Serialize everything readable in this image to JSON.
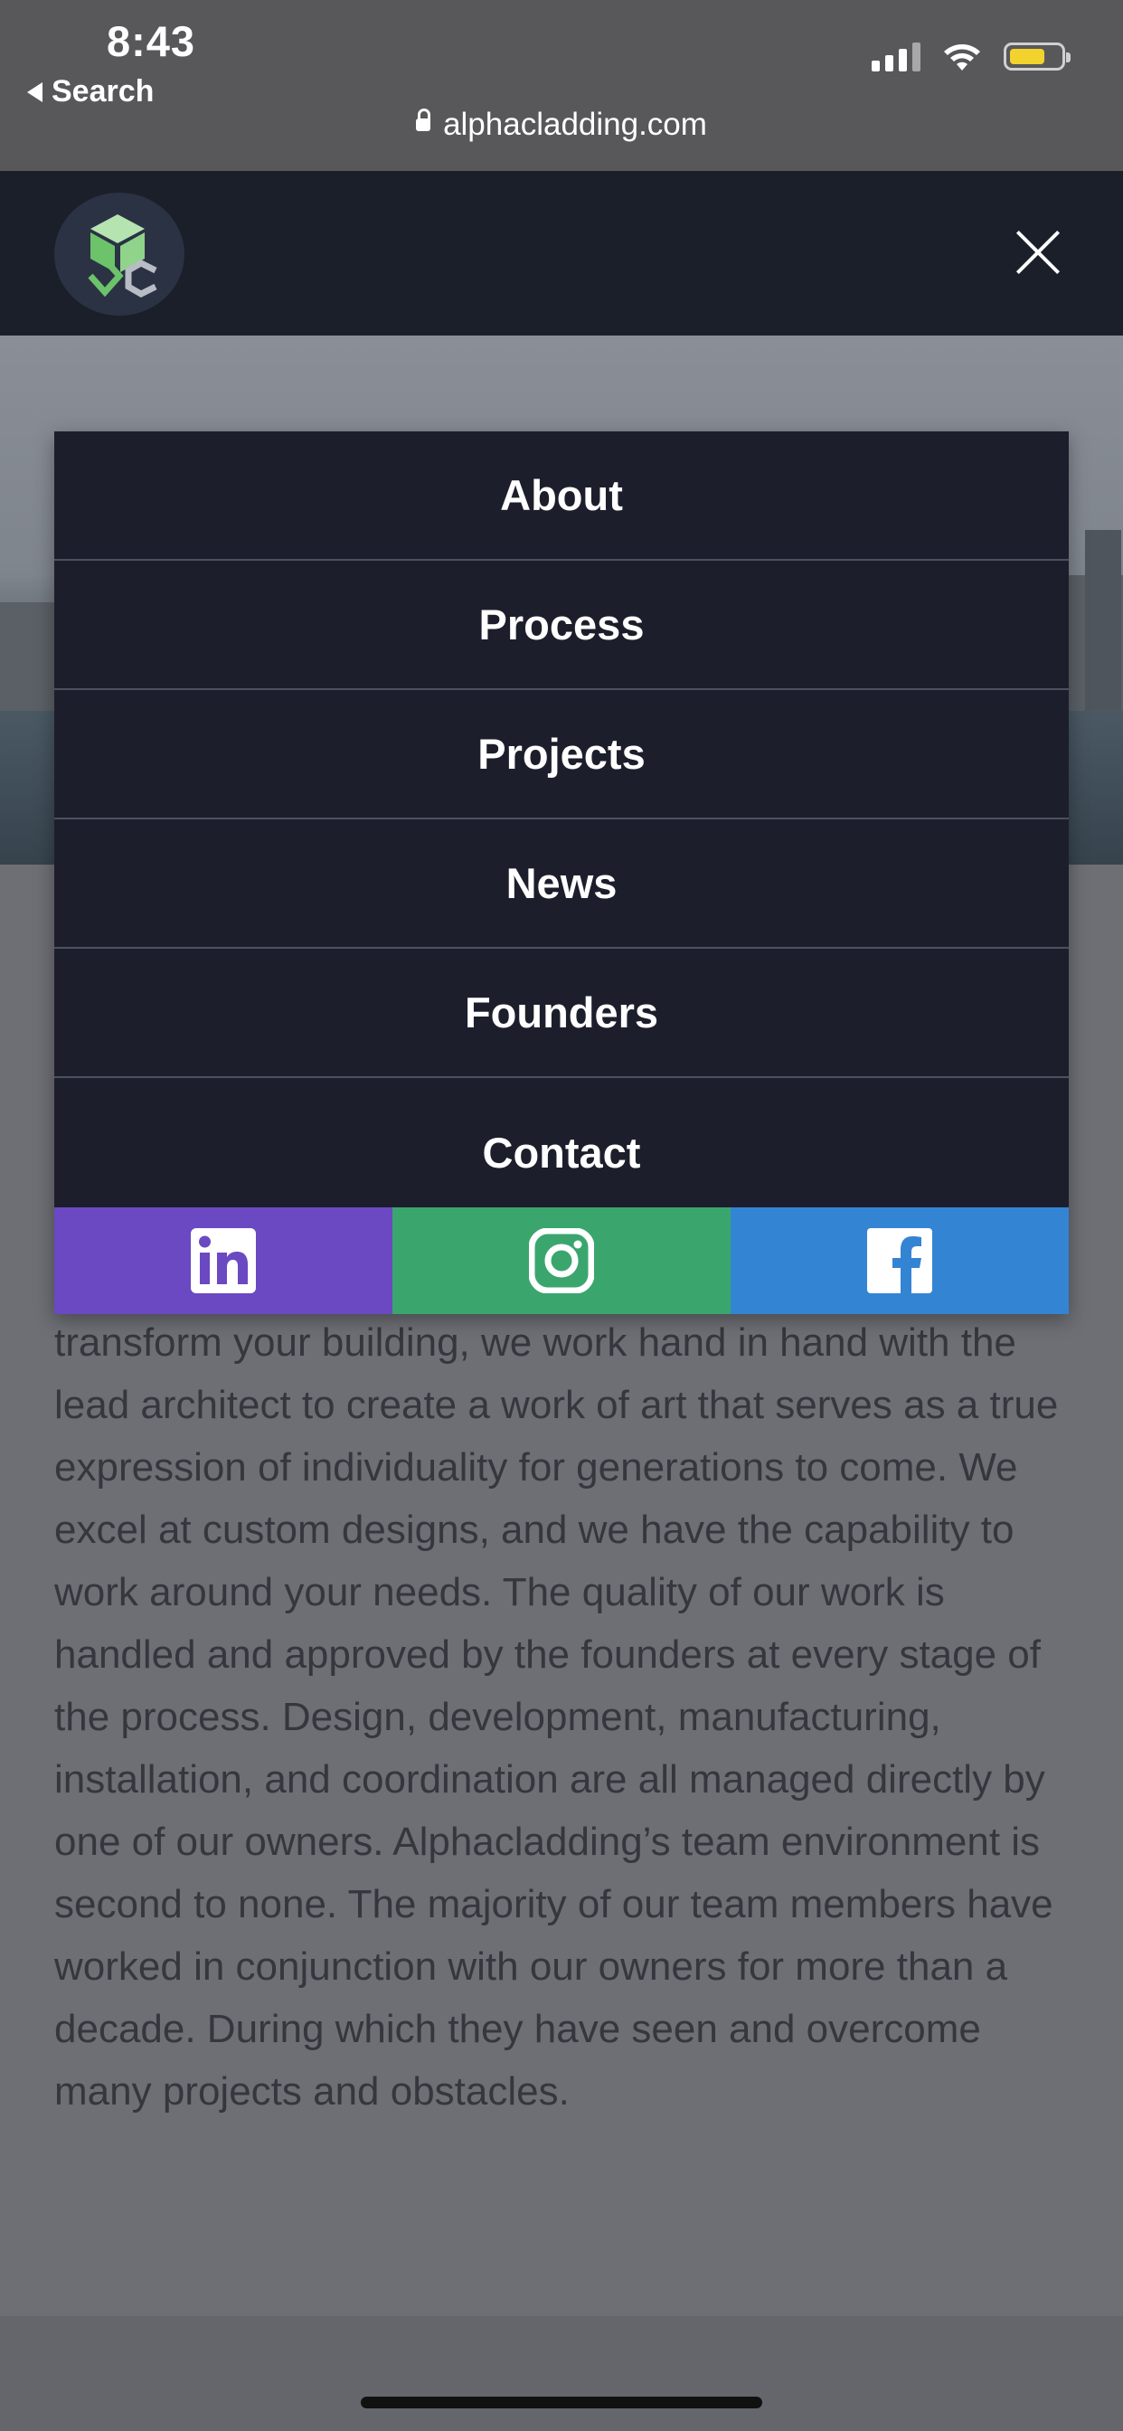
{
  "status_bar": {
    "time": "8:43",
    "back_label": "Search"
  },
  "browser": {
    "url": "alphacladding.com"
  },
  "header": {
    "logo_icon": "alphacladding-logo-icon",
    "close_icon": "close-icon"
  },
  "menu": {
    "items": [
      {
        "label": "About"
      },
      {
        "label": "Process"
      },
      {
        "label": "Projects"
      },
      {
        "label": "News"
      },
      {
        "label": "Founders"
      },
      {
        "label": "Contact"
      }
    ],
    "social": [
      {
        "icon": "linkedin-icon",
        "color": "#6a49c2"
      },
      {
        "icon": "instagram-icon",
        "color": "#3aa66e"
      },
      {
        "icon": "facebook-icon",
        "color": "#3484d4"
      }
    ]
  },
  "content": {
    "paragraph": "transform your building, we work hand in hand with the lead architect to create a work of art that serves as a true expression of individuality for generations to come. We excel at custom designs, and we have the capability to work around your needs. The quality of our work is handled and approved by the founders at every stage of the process. Design, development, manufacturing, installation, and coordination are all managed directly by one of our owners. Alphacladding’s team environment is second to none. The majority of our team members have worked in conjunction with our owners for more than a decade. During which they have seen and overcome many projects and obstacles."
  },
  "colors": {
    "header_bg": "#1b1f2a",
    "menu_bg": "#1c1f2b",
    "battery": "#f2d22c",
    "logo_green": "#6cc36a"
  }
}
